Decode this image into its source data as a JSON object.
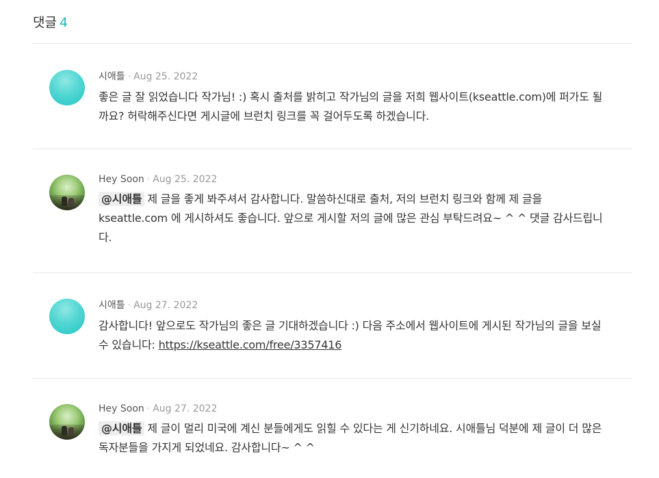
{
  "header": {
    "title": "댓글",
    "count": "4"
  },
  "comments": [
    {
      "author": "시애틀",
      "date": "Aug 25. 2022",
      "avatar": "teal-circle-avatar",
      "text": "좋은 글 잘 읽었습니다 작가님! :) 혹시 출처를 밝히고 작가님의 글을 저희 웹사이트(kseattle.com)에 퍼가도 될까요? 허락해주신다면 게시글에 브런치 링크를 꼭 걸어두도록 하겠습니다."
    },
    {
      "author": "Hey Soon",
      "date": "Aug 25. 2022",
      "avatar": "photo-avatar",
      "mention": "@시애틀",
      "text": "제 글을 좋게 봐주셔서 감사합니다. 말씀하신대로 출처, 저의 브런치 링크와 함께 제 글을 kseattle.com 에 게시하셔도 좋습니다. 앞으로 게시할 저의 글에 많은 관심 부탁드려요~ ^ ^ 댓글 감사드립니다."
    },
    {
      "author": "시애틀",
      "date": "Aug 27. 2022",
      "avatar": "teal-circle-avatar",
      "text": "감사합니다! 앞으로도 작가님의 좋은 글 기대하겠습니다 :) 다음 주소에서 웹사이트에 게시된 작가님의 글을 보실 수 있습니다: ",
      "link": "https://kseattle.com/free/3357416"
    },
    {
      "author": "Hey Soon",
      "date": "Aug 27. 2022",
      "avatar": "photo-avatar",
      "mention": "@시애틀",
      "text": "제 글이 멀리 미국에 계신 분들에게도 읽힐 수 있다는 게 신기하네요. 시애틀님 덕분에 제 글이 더 많은 독자분들을 가지게 되었네요. 감사합니다~ ^ ^"
    }
  ]
}
